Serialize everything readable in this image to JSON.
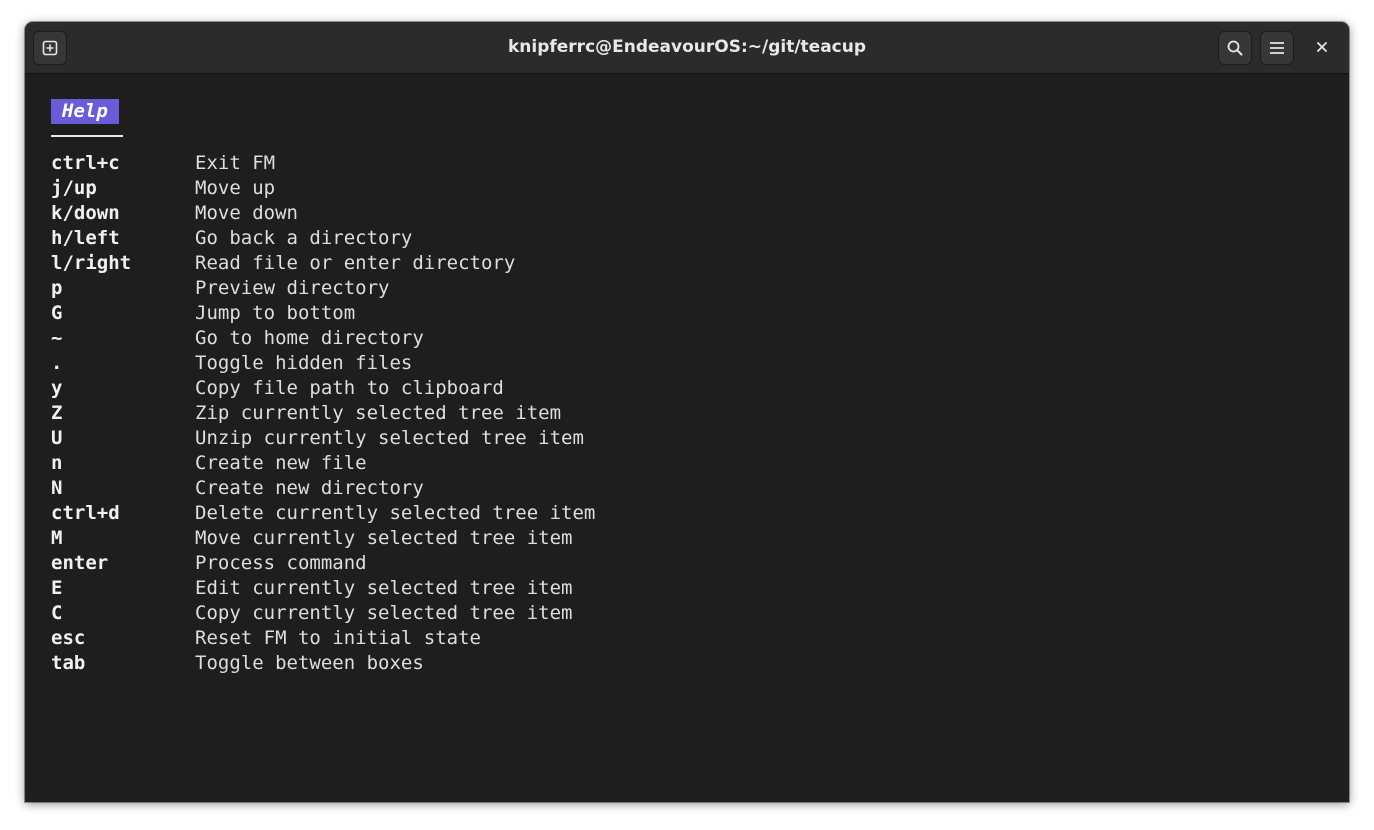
{
  "window": {
    "title": "knipferrc@EndeavourOS:~/git/teacup"
  },
  "titlebar": {
    "new_tab_icon": "new-tab-icon",
    "search_icon": "search-icon",
    "menu_icon": "hamburger-menu-icon",
    "close_icon": "close-icon"
  },
  "help": {
    "heading": "Help",
    "accent_color": "#6a5bd8",
    "rows": [
      {
        "key": "ctrl+c",
        "desc": "Exit FM"
      },
      {
        "key": "j/up",
        "desc": "Move up"
      },
      {
        "key": "k/down",
        "desc": "Move down"
      },
      {
        "key": "h/left",
        "desc": "Go back a directory"
      },
      {
        "key": "l/right",
        "desc": "Read file or enter directory"
      },
      {
        "key": "p",
        "desc": "Preview directory"
      },
      {
        "key": "G",
        "desc": "Jump to bottom"
      },
      {
        "key": "~",
        "desc": "Go to home directory"
      },
      {
        "key": ".",
        "desc": "Toggle hidden files"
      },
      {
        "key": "y",
        "desc": "Copy file path to clipboard"
      },
      {
        "key": "Z",
        "desc": "Zip currently selected tree item"
      },
      {
        "key": "U",
        "desc": "Unzip currently selected tree item"
      },
      {
        "key": "n",
        "desc": "Create new file"
      },
      {
        "key": "N",
        "desc": "Create new directory"
      },
      {
        "key": "ctrl+d",
        "desc": "Delete currently selected tree item"
      },
      {
        "key": "M",
        "desc": "Move currently selected tree item"
      },
      {
        "key": "enter",
        "desc": "Process command"
      },
      {
        "key": "E",
        "desc": "Edit currently selected tree item"
      },
      {
        "key": "C",
        "desc": "Copy currently selected tree item"
      },
      {
        "key": "esc",
        "desc": "Reset FM to initial state"
      },
      {
        "key": "tab",
        "desc": "Toggle between boxes"
      }
    ]
  }
}
